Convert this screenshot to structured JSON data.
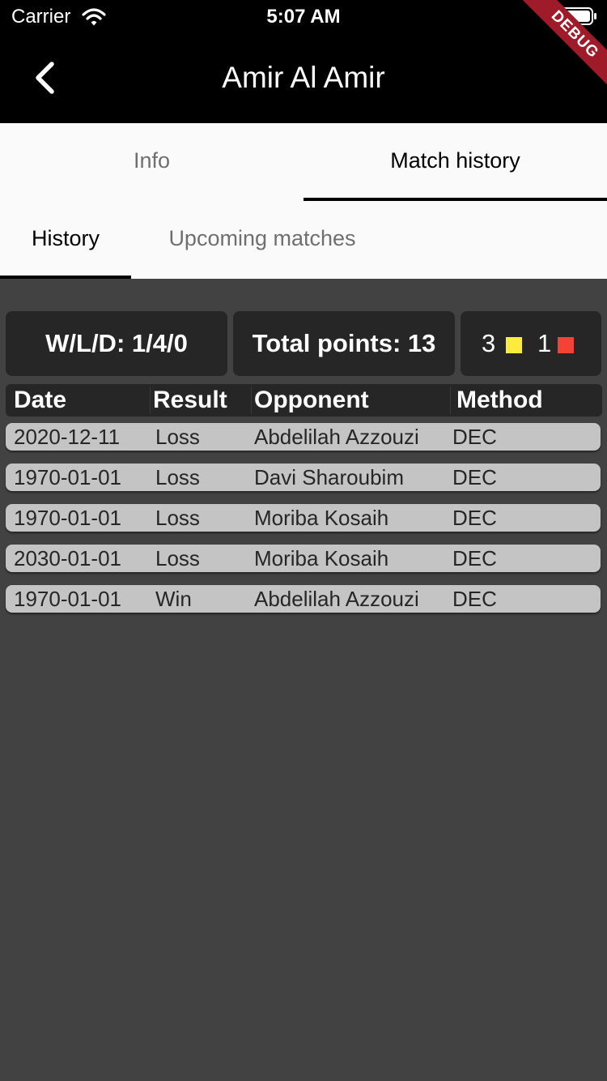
{
  "status_bar": {
    "carrier": "Carrier",
    "time": "5:07 AM",
    "wifi_icon": "wifi-icon",
    "battery_icon": "battery-icon"
  },
  "debug_banner": "DEBUG",
  "app_bar": {
    "title": "Amir Al Amir",
    "back_icon": "chevron-left-icon"
  },
  "main_tabs": [
    {
      "label": "Info",
      "selected": false
    },
    {
      "label": "Match history",
      "selected": true
    }
  ],
  "sub_tabs": [
    {
      "label": "History",
      "selected": true
    },
    {
      "label": "Upcoming matches",
      "selected": false
    }
  ],
  "stats": {
    "wld": "W/L/D: 1/4/0",
    "total_points": "Total points: 13",
    "yellow_cards": "3",
    "red_cards": "1",
    "yellow_color": "#ffeb3b",
    "red_color": "#f44336"
  },
  "table": {
    "headers": [
      "Date",
      "Result",
      "Opponent",
      "Method"
    ],
    "rows": [
      {
        "date": "2020-12-11",
        "result": "Loss",
        "opponent": "Abdelilah Azzouzi",
        "method": "DEC"
      },
      {
        "date": "1970-01-01",
        "result": "Loss",
        "opponent": "Davi Sharoubim",
        "method": "DEC"
      },
      {
        "date": "1970-01-01",
        "result": "Loss",
        "opponent": "Moriba Kosaih",
        "method": "DEC"
      },
      {
        "date": "2030-01-01",
        "result": "Loss",
        "opponent": "Moriba Kosaih",
        "method": "DEC"
      },
      {
        "date": "1970-01-01",
        "result": "Win",
        "opponent": "Abdelilah Azzouzi",
        "method": "DEC"
      }
    ]
  },
  "colors": {
    "app_bar": "#000000",
    "tab_background": "#fafafa",
    "body_background": "#424242",
    "card_background": "#262626",
    "row_background": "#c4c4c4",
    "debug_ribbon": "#a01b29"
  }
}
